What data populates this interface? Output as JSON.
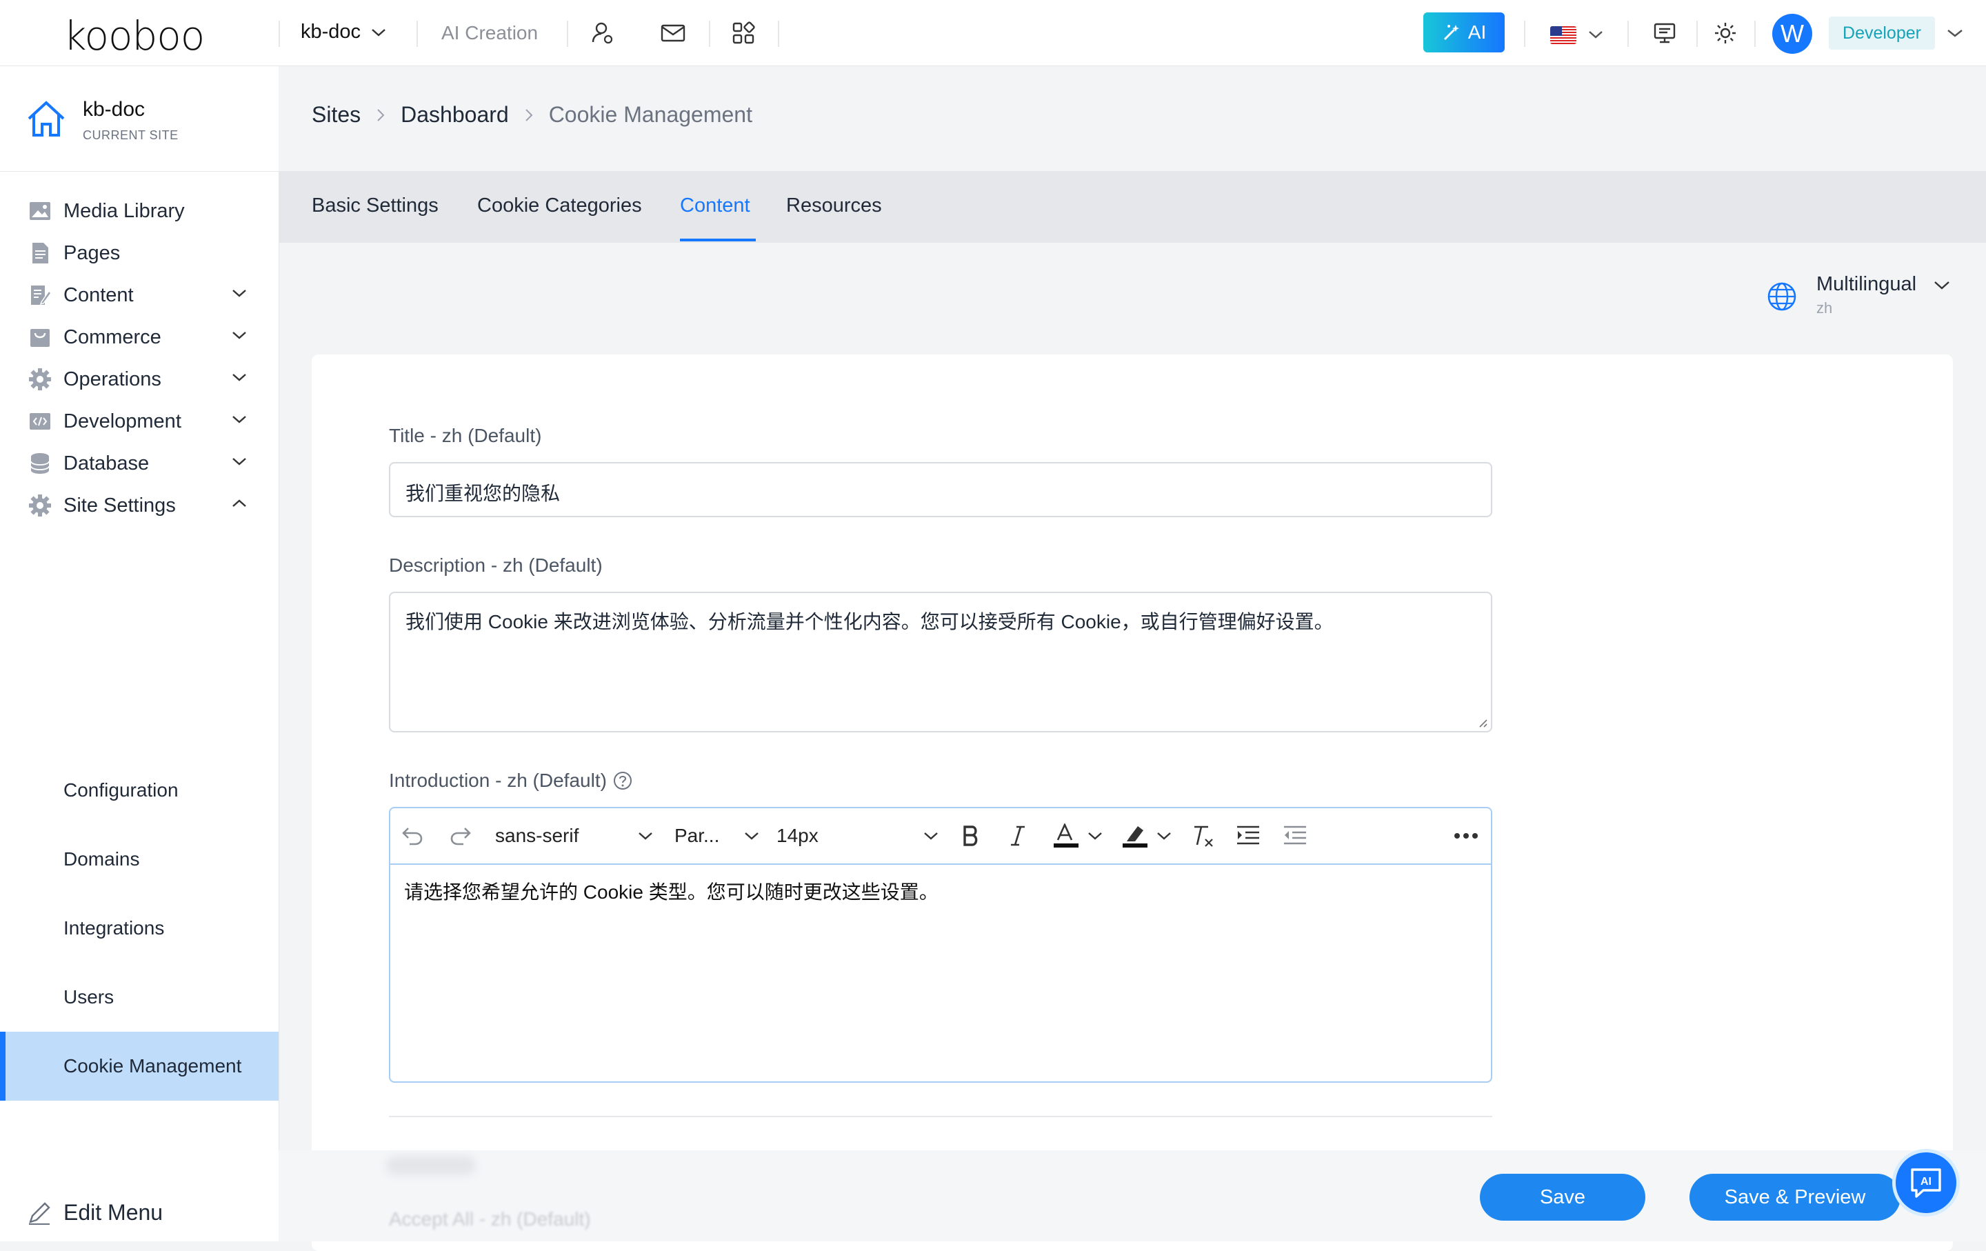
{
  "app": {
    "logo": "kooboo",
    "site_selector": "kb-doc",
    "ai_creation": "AI Creation",
    "ai_button": "AI",
    "user_initial": "W",
    "user_role": "Developer"
  },
  "sidebar": {
    "site_name": "kb-doc",
    "site_caption": "CURRENT SITE",
    "items": [
      {
        "label": "Media Library",
        "icon": "image-icon"
      },
      {
        "label": "Pages",
        "icon": "page-icon"
      },
      {
        "label": "Content",
        "icon": "edit-doc-icon"
      },
      {
        "label": "Commerce",
        "icon": "bag-icon"
      },
      {
        "label": "Operations",
        "icon": "gear-icon"
      },
      {
        "label": "Development",
        "icon": "code-icon"
      },
      {
        "label": "Database",
        "icon": "database-icon"
      },
      {
        "label": "Site Settings",
        "icon": "gear-icon"
      }
    ],
    "sub_items": [
      "Configuration",
      "Domains",
      "Integrations",
      "Users",
      "Cookie Management"
    ],
    "active_sub": "Cookie Management",
    "edit_menu": "Edit Menu"
  },
  "breadcrumb": [
    "Sites",
    "Dashboard",
    "Cookie Management"
  ],
  "tabs": [
    "Basic Settings",
    "Cookie Categories",
    "Content",
    "Resources"
  ],
  "active_tab": "Content",
  "language": {
    "label": "Multilingual",
    "code": "zh"
  },
  "form": {
    "title_label": "Title - zh (Default)",
    "title_value": "我们重视您的隐私",
    "description_label": "Description - zh (Default)",
    "description_value": "我们使用 Cookie 来改进浏览体验、分析流量并个性化内容。您可以接受所有 Cookie，或自行管理偏好设置。",
    "introduction_label": "Introduction - zh (Default)",
    "introduction_value": "请选择您希望允许的 Cookie 类型。您可以随时更改这些设置。",
    "accept_all_label": "Accept All - zh (Default)"
  },
  "editor_toolbar": {
    "font_family": "sans-serif",
    "block_format": "Par...",
    "font_size": "14px"
  },
  "actions": {
    "save": "Save",
    "save_preview": "Save & Preview",
    "assistant": "AI"
  },
  "colors": {
    "primary": "#1677ff",
    "active_bg": "#bfdcfb"
  }
}
